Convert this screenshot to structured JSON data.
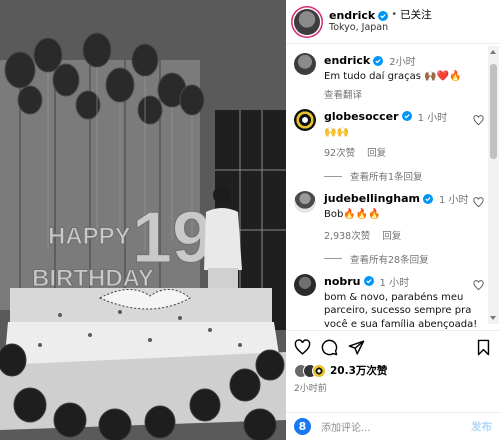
{
  "post": {
    "username": "endrick",
    "follow_status": "已关注",
    "location": "Tokyo, Japan",
    "photo": {
      "balloon_happy": "HAPPY",
      "balloon_birthday": "BIRTHDAY",
      "balloon_number": "19"
    }
  },
  "comments": [
    {
      "username": "endrick",
      "time": "2小时",
      "text": "Em tudo daí graças 🙌🏾❤️🔥",
      "translate": "查看翻译"
    },
    {
      "username": "globesoccer",
      "time": "1 小时",
      "text": "🙌🙌",
      "likes": "92次赞",
      "reply": "回复",
      "view_replies": "查看所有1条回复"
    },
    {
      "username": "judebellingham",
      "time": "1 小时",
      "text": "Bob🔥🔥🔥",
      "likes": "2,938次赞",
      "reply": "回复",
      "view_replies": "查看所有28条回复"
    },
    {
      "username": "nobru",
      "time": "1 小时",
      "text": "bom & novo, parabéns meu parceiro, sucesso sempre pra você e sua família abençoada!"
    }
  ],
  "actions": {
    "likes": "20.3万次赞",
    "posted_time": "2小时前"
  },
  "comment_box": {
    "placeholder": "添加评论...",
    "post_label": "发布"
  },
  "colors": {
    "verified_blue": "#0095f6",
    "story_ring": "#d62976"
  }
}
